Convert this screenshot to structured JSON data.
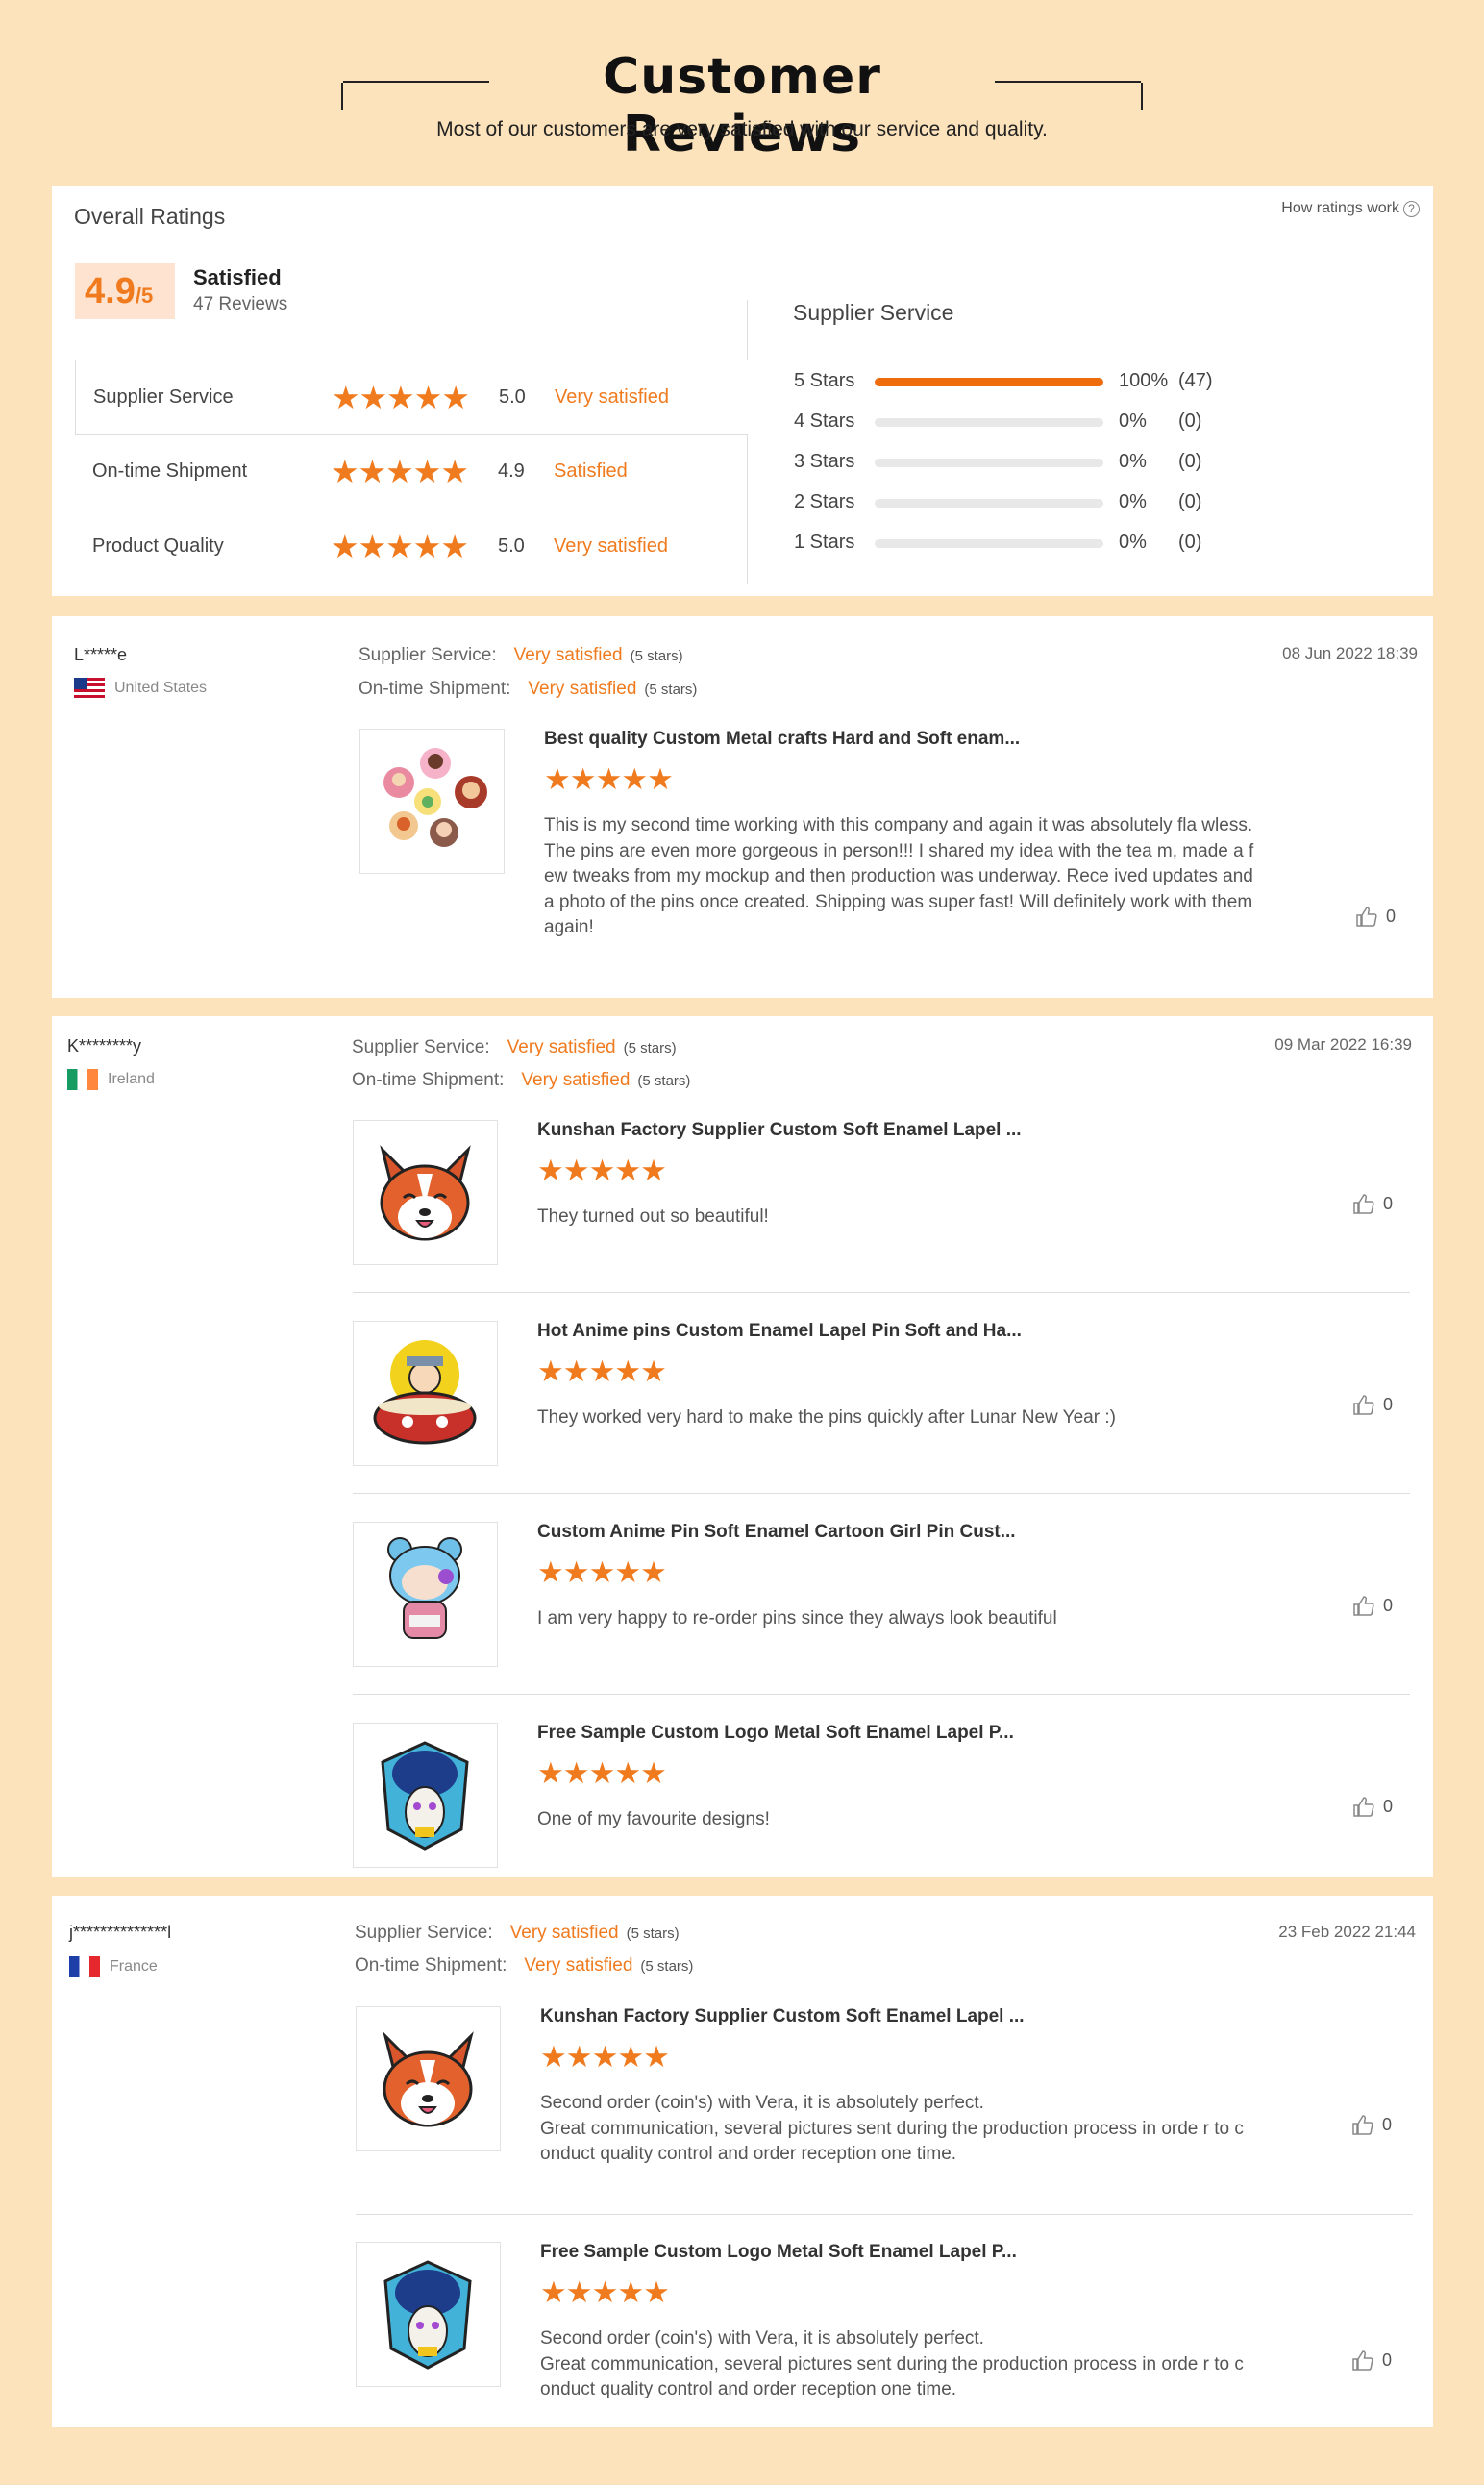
{
  "header": {
    "title": "Customer  Reviews",
    "subtitle": "Most of our customers are very satisfied with our service and quality."
  },
  "overall": {
    "title": "Overall Ratings",
    "how_link": "How ratings work",
    "help_icon": "?",
    "score": "4.9",
    "score_suffix": "/5",
    "score_label": "Satisfied",
    "reviews_count": "47 Reviews",
    "rows": [
      {
        "label": "Supplier Service",
        "stars": 5,
        "value": "5.0",
        "desc": "Very satisfied"
      },
      {
        "label": "On-time Shipment",
        "stars": 5,
        "value": "4.9",
        "desc": "Satisfied"
      },
      {
        "label": "Product Quality",
        "stars": 5,
        "value": "5.0",
        "desc": "Very satisfied"
      }
    ],
    "distribution_title": "Supplier Service",
    "distribution": [
      {
        "label": "5  Stars",
        "fraction": 1.0,
        "pct": "100%",
        "count": "(47)"
      },
      {
        "label": "4  Stars",
        "fraction": 0,
        "pct": "0%",
        "count": "(0)"
      },
      {
        "label": "3  Stars",
        "fraction": 0,
        "pct": "0%",
        "count": "(0)"
      },
      {
        "label": "2  Stars",
        "fraction": 0,
        "pct": "0%",
        "count": "(0)"
      },
      {
        "label": "1  Stars",
        "fraction": 0,
        "pct": "0%",
        "count": "(0)"
      }
    ]
  },
  "stars_glyph": "★★★★★",
  "meta_labels": {
    "service": "Supplier Service:",
    "shipment": "On-time Shipment:"
  },
  "reviews": [
    {
      "user": "L*****e",
      "country": "United States",
      "date": "08 Jun 2022 18:39",
      "service": "Very satisfied",
      "service_stars": "(5 stars)",
      "shipment": "Very satisfied",
      "shipment_stars": "(5 stars)",
      "items": [
        {
          "title": "Best quality Custom Metal crafts Hard and Soft enam...",
          "text": "This is my second time working with this company and again it was absolutely fla wless. The pins are even more gorgeous in person!!! I shared my idea with the tea m, made a few tweaks from my mockup and then production was underway. Rece ived updates and a photo of the pins once created. Shipping was super fast! Will definitely work with them again!",
          "likes": "0"
        }
      ]
    },
    {
      "user": "K********y",
      "country": "Ireland",
      "date": "09 Mar 2022 16:39",
      "service": "Very satisfied",
      "service_stars": "(5 stars)",
      "shipment": "Very satisfied",
      "shipment_stars": "(5 stars)",
      "items": [
        {
          "title": "Kunshan Factory Supplier Custom Soft Enamel Lapel ...",
          "text": "They turned out so beautiful!",
          "likes": "0"
        },
        {
          "title": "Hot Anime pins Custom Enamel Lapel Pin Soft and Ha...",
          "text": "They worked very hard to make the pins quickly after Lunar New Year :)",
          "likes": "0"
        },
        {
          "title": "Custom Anime Pin Soft Enamel Cartoon Girl Pin Cust...",
          "text": "I am very happy to re-order pins since they always look beautiful",
          "likes": "0"
        },
        {
          "title": "Free Sample Custom Logo Metal Soft Enamel Lapel P...",
          "text": "One of my favourite designs!",
          "likes": "0"
        }
      ]
    },
    {
      "user": "j**************l",
      "country": "France",
      "date": "23 Feb 2022 21:44",
      "service": "Very satisfied",
      "service_stars": "(5 stars)",
      "shipment": "Very satisfied",
      "shipment_stars": "(5 stars)",
      "items": [
        {
          "title": "Kunshan Factory Supplier Custom Soft Enamel Lapel ...",
          "text": "Second order (coin's) with Vera, it is absolutely perfect.\nGreat communication, several pictures sent during the production process in orde r to conduct quality control and order reception one time.",
          "likes": "0"
        },
        {
          "title": "Free Sample Custom Logo Metal Soft Enamel Lapel P...",
          "text": "Second order (coin's) with Vera, it is absolutely perfect.\nGreat communication, several pictures sent during the production process in orde r to conduct quality control and order reception one time.",
          "likes": "0"
        }
      ]
    }
  ],
  "colors": {
    "accent": "#f07a1e",
    "background": "#fde3bb",
    "bar_fill": "#ef6c0c"
  },
  "icons": {
    "like": "thumbs-up-icon",
    "help": "question-circle-icon"
  }
}
